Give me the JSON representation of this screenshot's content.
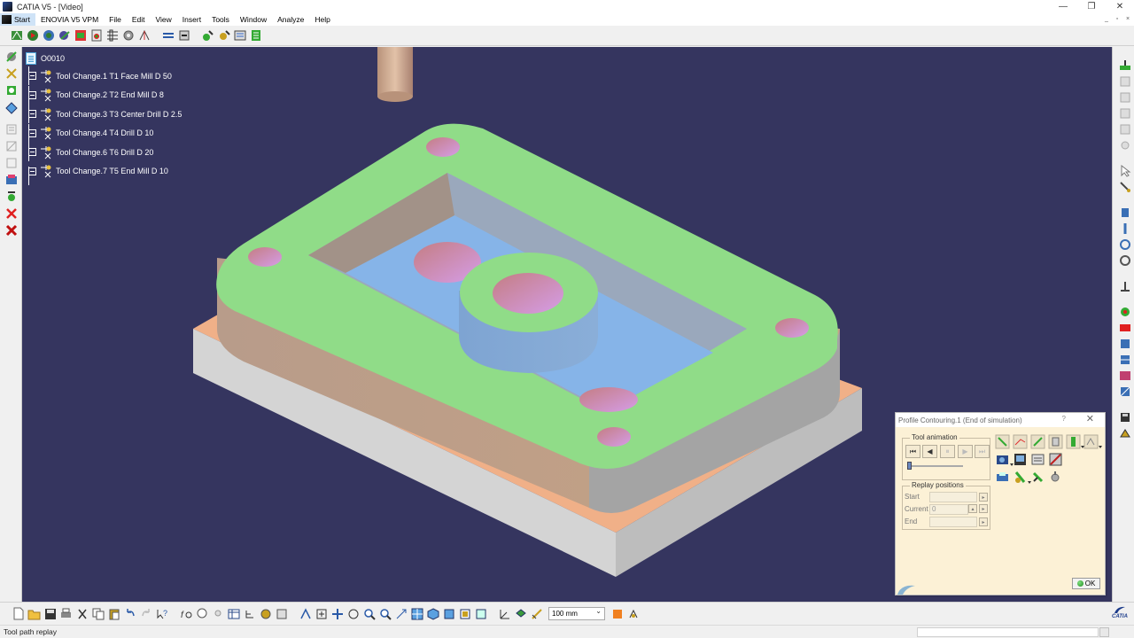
{
  "window": {
    "title": "CATIA V5 - [Video]",
    "controls": [
      "—",
      "❐",
      "✕"
    ]
  },
  "menu": {
    "items": [
      "Start",
      "ENOVIA V5 VPM",
      "File",
      "Edit",
      "View",
      "Insert",
      "Tools",
      "Window",
      "Analyze",
      "Help"
    ],
    "mdi_controls": [
      "_",
      "▫",
      "×"
    ]
  },
  "tree": {
    "root": "O0010",
    "items": [
      {
        "label": "Tool Change.1  T1 Face Mill D 50"
      },
      {
        "label": "Tool Change.2  T2 End Mill D 8"
      },
      {
        "label": "Tool Change.3  T3 Center Drill D 2.5"
      },
      {
        "label": "Tool Change.4  T4 Drill D 10"
      },
      {
        "label": "Tool Change.6  T6 Drill D 20"
      },
      {
        "label": "Tool Change.7  T5 End Mill D 10"
      }
    ]
  },
  "dialog": {
    "title": "Profile Contouring.1 (End of simulation)",
    "help": "?",
    "close": "✕",
    "tool_animation": {
      "legend": "Tool animation",
      "buttons": [
        "⏮",
        "◀",
        "⏸",
        "▶",
        "⏭"
      ]
    },
    "replay": {
      "legend": "Replay positions",
      "start_label": "Start",
      "current_label": "Current",
      "current_value": "0",
      "end_label": "End"
    },
    "ok_label": "OK"
  },
  "bottom_toolbar": {
    "zoom_value": "100 mm"
  },
  "status": {
    "text": "Tool path replay"
  },
  "colors": {
    "viewport_bg": "#35355f",
    "part_top": "#90dc88",
    "part_side": "#c09c80",
    "pocket_floor": "#86b4e8",
    "stock_side": "#d4d4d4",
    "stock_top": "#f0b088",
    "hole": "#c890b0",
    "dialog_bg": "#fcf1d6"
  },
  "logo_text": "CATIA"
}
